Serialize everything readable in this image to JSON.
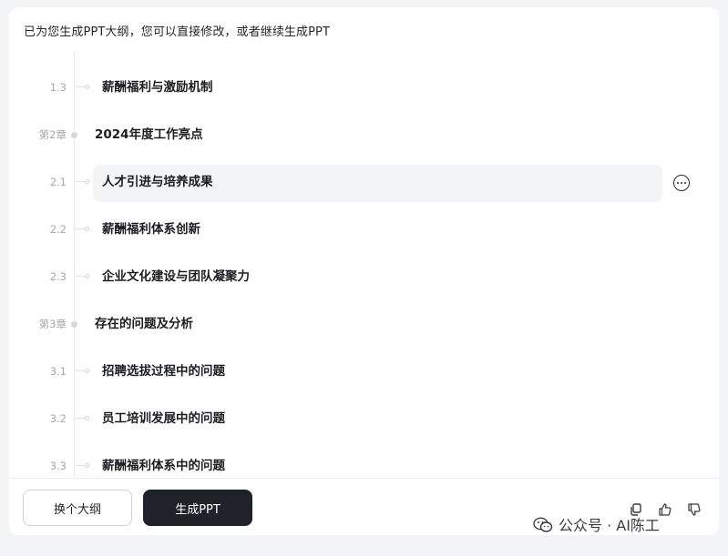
{
  "intro_text": "已为您生成PPT大纲，您可以直接修改，或者继续生成PPT",
  "outline": [
    {
      "kind": "sub",
      "num": "1.3",
      "title": "薪酬福利与激励机制"
    },
    {
      "kind": "chap",
      "num": "第2章",
      "title": "2024年度工作亮点"
    },
    {
      "kind": "sub",
      "num": "2.1",
      "title": "人才引进与培养成果",
      "active": true
    },
    {
      "kind": "sub",
      "num": "2.2",
      "title": "薪酬福利体系创新"
    },
    {
      "kind": "sub",
      "num": "2.3",
      "title": "企业文化建设与团队凝聚力"
    },
    {
      "kind": "chap",
      "num": "第3章",
      "title": "存在的问题及分析"
    },
    {
      "kind": "sub",
      "num": "3.1",
      "title": "招聘选拔过程中的问题"
    },
    {
      "kind": "sub",
      "num": "3.2",
      "title": "员工培训发展中的问题"
    },
    {
      "kind": "sub",
      "num": "3.3",
      "title": "薪酬福利体系中的问题"
    }
  ],
  "footer": {
    "change_outline_label": "换个大纲",
    "generate_label": "生成PPT"
  },
  "icons": {
    "more": "more-horizontal-circle-icon",
    "copy": "copy-icon",
    "like": "thumbs-up-icon",
    "dislike": "thumbs-down-icon",
    "watermark_logo": "wechat-icon"
  },
  "watermark": "公众号 · AI陈工",
  "colors": {
    "background": "#f3f4f6",
    "primary_button": "#1f2329",
    "muted_text": "#a4a8b0",
    "highlight_row": "#f3f4f6"
  }
}
